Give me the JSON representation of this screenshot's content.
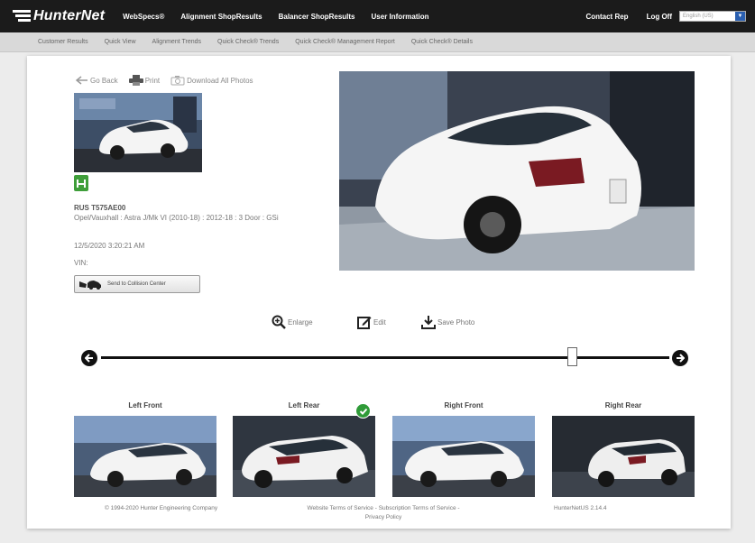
{
  "brand": {
    "name": "HunterNet"
  },
  "top_nav": {
    "items": [
      "WebSpecs®",
      "Alignment ShopResults",
      "Balancer ShopResults",
      "User Information"
    ],
    "right": [
      "Contact Rep",
      "Log Off"
    ],
    "language_value": "English (US)"
  },
  "sub_nav": {
    "items": [
      "Customer Results",
      "Quick View",
      "Alignment Trends",
      "Quick Check® Trends",
      "Quick Check® Management Report",
      "Quick Check® Details"
    ]
  },
  "actions": {
    "go_back": "Go Back",
    "print": "Print",
    "download": "Download All Photos"
  },
  "vehicle": {
    "plate": "RUS T575AE00",
    "description": "Opel/Vauxhall : Astra J/Mk VI (2010-18) : 2012-18 : 3 Door : GSi",
    "datetime": "12/5/2020 3:20:21 AM",
    "vin": "VIN:"
  },
  "collision_button": "Send to Collision Center",
  "tools": {
    "enlarge": "Enlarge",
    "edit": "Edit",
    "save": "Save Photo"
  },
  "slider": {
    "value_fraction": 0.83
  },
  "gallery": [
    {
      "label": "Left Front"
    },
    {
      "label": "Left Rear",
      "selected": true
    },
    {
      "label": "Right Front"
    },
    {
      "label": "Right Rear"
    }
  ],
  "footer": {
    "copyright": "© 1994-2020 Hunter Engineering Company",
    "terms_line1": "Website Terms of Service - Subscription Terms of Service -",
    "terms_line2": "Privacy Policy",
    "version": "HunterNetUS 2.14.4"
  },
  "colors": {
    "topbar": "#1b1b1b",
    "subbar": "#d9d9d9",
    "accent_green": "#3f9e3a"
  }
}
